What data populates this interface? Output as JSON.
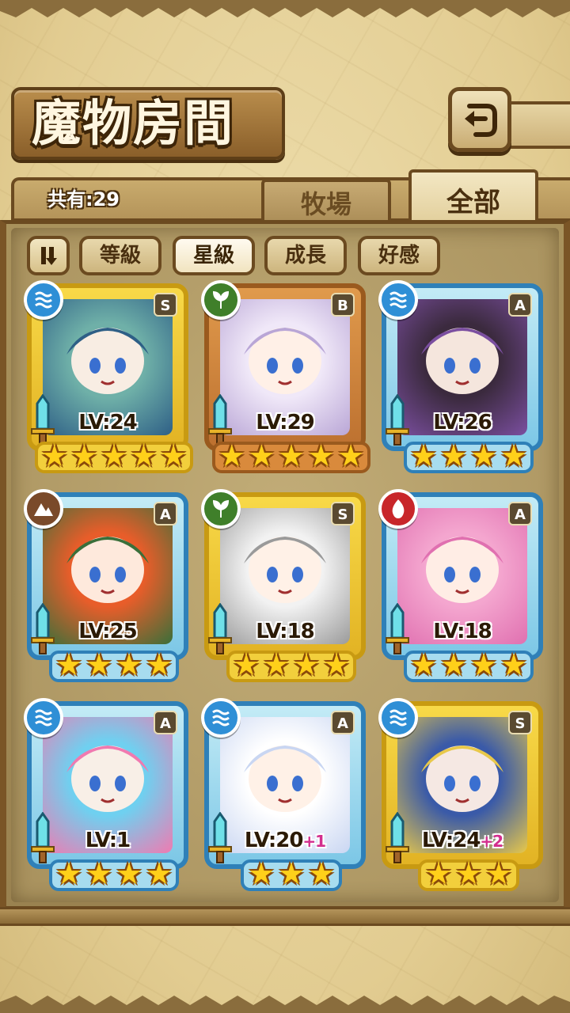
{
  "header": {
    "title": "魔物房間",
    "back_icon": "return-arrow-icon"
  },
  "summary": {
    "count_label": "共有:29"
  },
  "tabs": [
    {
      "label": "牧場",
      "selected": false
    },
    {
      "label": "全部",
      "selected": true
    }
  ],
  "sort": {
    "toggle_icon": "sort-order-toggle-icon",
    "buttons": [
      {
        "label": "等級",
        "active": false
      },
      {
        "label": "星級",
        "active": true
      },
      {
        "label": "成長",
        "active": false
      },
      {
        "label": "好感",
        "active": false
      }
    ]
  },
  "monsters": [
    {
      "level": "LV:24",
      "bonus": "",
      "rank": "S",
      "element": "water",
      "stars": 5,
      "frame": "gold"
    },
    {
      "level": "LV:29",
      "bonus": "",
      "rank": "B",
      "element": "wood",
      "stars": 5,
      "frame": "bronze"
    },
    {
      "level": "LV:26",
      "bonus": "",
      "rank": "A",
      "element": "water",
      "stars": 4,
      "frame": "blue"
    },
    {
      "level": "LV:25",
      "bonus": "",
      "rank": "A",
      "element": "earth",
      "stars": 4,
      "frame": "blue"
    },
    {
      "level": "LV:18",
      "bonus": "",
      "rank": "S",
      "element": "wood",
      "stars": 4,
      "frame": "gold"
    },
    {
      "level": "LV:18",
      "bonus": "",
      "rank": "A",
      "element": "fire",
      "stars": 4,
      "frame": "blue"
    },
    {
      "level": "LV:1",
      "bonus": "",
      "rank": "A",
      "element": "water",
      "stars": 4,
      "frame": "blue"
    },
    {
      "level": "LV:20",
      "bonus": "+1",
      "rank": "A",
      "element": "water",
      "stars": 3,
      "frame": "blue"
    },
    {
      "level": "LV:24",
      "bonus": "+2",
      "rank": "S",
      "element": "water",
      "stars": 3,
      "frame": "gold"
    }
  ],
  "colors": {
    "water": "#2f8fd6",
    "wood": "#3f7f2a",
    "earth": "#7a4a2a",
    "fire": "#c8262a"
  }
}
